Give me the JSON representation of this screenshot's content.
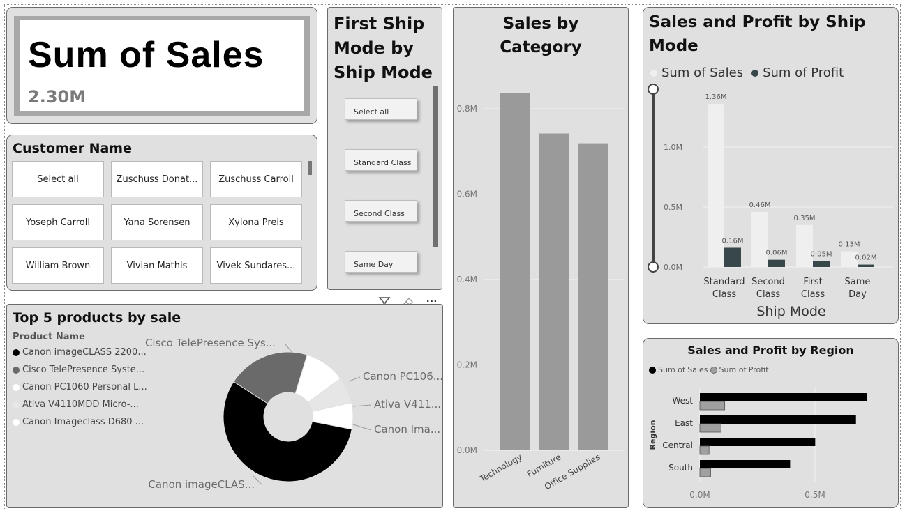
{
  "kpi": {
    "title": "Sum of Sales",
    "value": "2.30M"
  },
  "customer_slicer": {
    "title": "Customer Name",
    "items": [
      "Select all",
      "Zuschuss Donat...",
      "Zuschuss Carroll",
      "Yoseph Carroll",
      "Yana Sorensen",
      "Xylona Preis",
      "William Brown",
      "Vivian Mathis",
      "Vivek Sundares..."
    ]
  },
  "ship_slicer": {
    "title_lines": [
      "First Ship",
      "Mode by",
      "Ship Mode"
    ],
    "items": [
      "Select all",
      "Standard Class",
      "Second Class",
      "Same Day"
    ]
  },
  "visual_actions": {
    "filter_icon": "filter-icon",
    "eraser_icon": "eraser-icon",
    "more_label": "···"
  },
  "colors": {
    "tile_bg": "#e0e0e0",
    "bar_gray": "#9a9a9a",
    "profit_dark": "#37474a",
    "sales_light": "#efefef",
    "black": "#000000"
  },
  "chart_data": [
    {
      "id": "category",
      "type": "bar",
      "title_lines": [
        "Sales by",
        "Category"
      ],
      "categories": [
        "Technology",
        "Furniture",
        "Office Supplies"
      ],
      "values": [
        0.836,
        0.742,
        0.719
      ],
      "ylim": [
        0,
        0.8
      ],
      "ticks": [
        "0.0M",
        "0.2M",
        "0.4M",
        "0.6M",
        "0.8M"
      ],
      "grid": true
    },
    {
      "id": "shipmode",
      "type": "bar",
      "title_lines": [
        "Sales and Profit by Ship",
        "Mode"
      ],
      "categories": [
        [
          "Standard",
          "Class"
        ],
        [
          "Second",
          "Class"
        ],
        [
          "First",
          "Class"
        ],
        [
          "Same",
          "Day"
        ]
      ],
      "series": [
        {
          "name": "Sum of Sales",
          "values": [
            1.36,
            0.46,
            0.35,
            0.13
          ],
          "labels": [
            "1.36M",
            "0.46M",
            "0.35M",
            "0.13M"
          ],
          "color": "#efefef"
        },
        {
          "name": "Sum of Profit",
          "values": [
            0.16,
            0.06,
            0.05,
            0.02
          ],
          "labels": [
            "0.16M",
            "0.06M",
            "0.05M",
            "0.02M"
          ],
          "color": "#37474a"
        }
      ],
      "xlabel": "Ship Mode",
      "ylim": [
        0,
        1.5
      ],
      "ticks": [
        "0.0M",
        "0.5M",
        "1.0M"
      ],
      "legend": "top-left"
    },
    {
      "id": "region",
      "type": "bar",
      "orientation": "horizontal",
      "title": "Sales and Profit by Region",
      "categories": [
        "West",
        "East",
        "Central",
        "South"
      ],
      "series": [
        {
          "name": "Sum of Sales",
          "values": [
            0.725,
            0.678,
            0.501,
            0.392
          ],
          "color": "#000000"
        },
        {
          "name": "Sum of Profit",
          "values": [
            0.108,
            0.092,
            0.04,
            0.047
          ],
          "color": "#a0a0a0"
        }
      ],
      "ylabel": "Region",
      "xlim": [
        0,
        0.8
      ],
      "ticks": [
        "0.0M",
        "0.5M"
      ],
      "legend": "top-left"
    },
    {
      "id": "products",
      "type": "pie",
      "title": "Top 5 products by sale",
      "legend_title": "Product Name",
      "legend_items": [
        "Canon imageCLASS 2200...",
        "Cisco TelePresence Syste...",
        "Canon PC1060 Personal L...",
        "Ativa V4110MDD Micro-...",
        "Canon Imageclass D680 ..."
      ],
      "slice_labels": [
        "Canon imageCLAS...",
        "Cisco TelePresence Sys...",
        "Canon PC106...",
        "Ativa V411...",
        "Canon Ima..."
      ],
      "values": [
        61600,
        22638,
        11200,
        7218,
        7196
      ],
      "colors": [
        "#000000",
        "#6a6a6a",
        "#ffffff",
        "#e6e6e6",
        "#ffffff"
      ]
    }
  ]
}
